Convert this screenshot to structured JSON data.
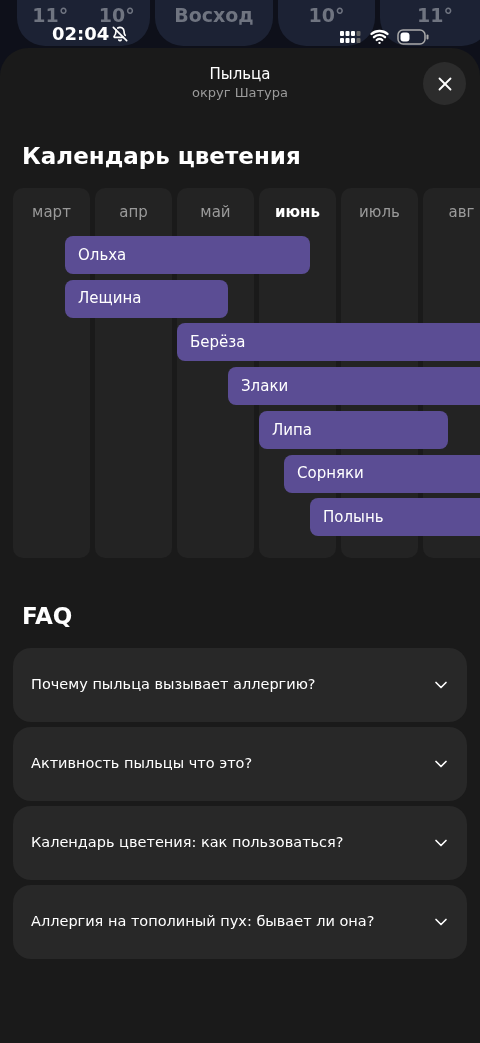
{
  "background_cards": [
    {
      "texts": [
        "11°",
        "10°"
      ]
    },
    {
      "texts": [
        "Восход"
      ]
    },
    {
      "texts": [
        "10°"
      ]
    },
    {
      "texts": [
        "11°"
      ]
    }
  ],
  "status_bar": {
    "time": "02:04",
    "silent": true
  },
  "sheet": {
    "title": "Пыльца",
    "subtitle": "округ Шатура"
  },
  "calendar": {
    "title": "Календарь цветения",
    "months": [
      {
        "label": "март",
        "selected": false
      },
      {
        "label": "апр",
        "selected": false
      },
      {
        "label": "май",
        "selected": false
      },
      {
        "label": "июнь",
        "selected": true
      },
      {
        "label": "июль",
        "selected": false
      },
      {
        "label": "авг",
        "selected": false
      }
    ],
    "bars": [
      {
        "label": "Ольха"
      },
      {
        "label": "Лещина"
      },
      {
        "label": "Берёза"
      },
      {
        "label": "Злаки"
      },
      {
        "label": "Липа"
      },
      {
        "label": "Сорняки"
      },
      {
        "label": "Полынь"
      }
    ]
  },
  "faq": {
    "title": "FAQ",
    "items": [
      {
        "question": "Почему пыльца вызывает аллергию?",
        "expanded": false
      },
      {
        "question": "Активность пыльцы что это?",
        "expanded": false
      },
      {
        "question": "Календарь цветения: как пользоваться?",
        "expanded": false
      },
      {
        "question": "Аллергия на тополиный пух: бывает ли она?",
        "expanded": false
      }
    ]
  }
}
